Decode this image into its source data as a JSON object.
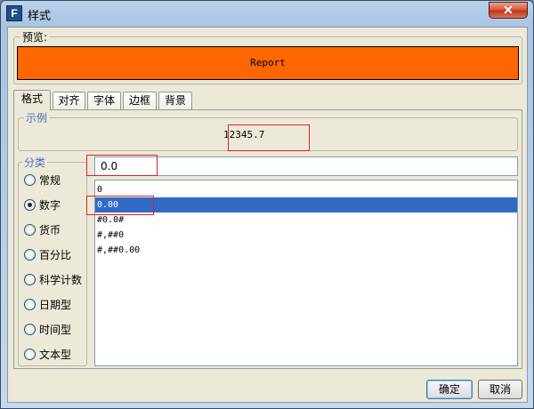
{
  "window": {
    "title": "样式",
    "close_label": "✕",
    "app_icon_glyph": "F"
  },
  "preview": {
    "label": "预览:",
    "text": "Report",
    "background": "#ff6600"
  },
  "tabs": [
    {
      "label": "格式",
      "active": true
    },
    {
      "label": "对齐",
      "active": false
    },
    {
      "label": "字体",
      "active": false
    },
    {
      "label": "边框",
      "active": false
    },
    {
      "label": "背景",
      "active": false
    }
  ],
  "example": {
    "label": "示例",
    "value": "12345.7"
  },
  "category": {
    "label": "分类",
    "options": [
      {
        "label": "常规",
        "checked": false
      },
      {
        "label": "数字",
        "checked": true
      },
      {
        "label": "货币",
        "checked": false
      },
      {
        "label": "百分比",
        "checked": false
      },
      {
        "label": "科学计数",
        "checked": false
      },
      {
        "label": "日期型",
        "checked": false
      },
      {
        "label": "时间型",
        "checked": false
      },
      {
        "label": "文本型",
        "checked": false
      }
    ]
  },
  "format_input": {
    "value": "0.0"
  },
  "format_list": {
    "items": [
      "0",
      "0.00",
      "#0.0#",
      "#,##0",
      "#,##0.00"
    ],
    "selected_index": 1
  },
  "buttons": {
    "ok_label": "确定",
    "cancel_label": "取消"
  },
  "colors": {
    "selection": "#316ac5",
    "highlight_box": "#e02020"
  }
}
